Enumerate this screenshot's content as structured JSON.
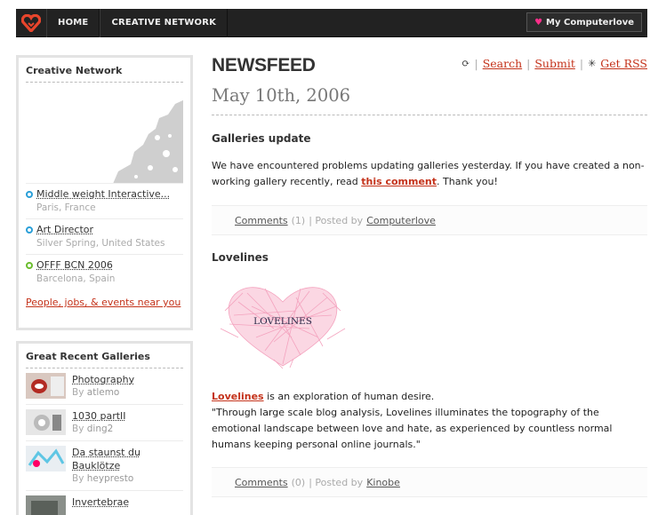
{
  "nav": {
    "home": "HOME",
    "creative_network": "CREATIVE NETWORK",
    "my_computerlove": "My Computerlove"
  },
  "sidebar": {
    "network": {
      "title": "Creative Network",
      "items": [
        {
          "title": "Middle weight Interactive...",
          "location": "Paris, France",
          "status": "blue"
        },
        {
          "title": "Art Director",
          "location": "Silver Spring, United States",
          "status": "blue"
        },
        {
          "title": "OFFF BCN 2006",
          "location": "Barcelona, Spain",
          "status": "green"
        }
      ],
      "near_link": "People, jobs, & events near you"
    },
    "galleries": {
      "title": "Great Recent Galleries",
      "by_label": "By",
      "items": [
        {
          "title": "Photography",
          "author": "atlemo"
        },
        {
          "title": "1030 partII",
          "author": "ding2"
        },
        {
          "title_line1": "Da staunst du",
          "title_line2": "Bauklötze",
          "author": "heypresto"
        },
        {
          "title": "Invertebrae"
        }
      ]
    }
  },
  "main": {
    "heading": "NEWSFEED",
    "links": {
      "search": "Search",
      "submit": "Submit",
      "rss": "Get RSS"
    },
    "date": "May 10th, 2006",
    "posts": [
      {
        "title": "Galleries update",
        "body_before": "We have encountered problems updating galleries yesterday. If you have created a non-working gallery recently, read ",
        "body_link": "this comment",
        "body_after": ". Thank you!",
        "comments_label": "Comments",
        "comments_count": "(1)",
        "posted_by_label": "| Posted by",
        "author": "Computerlove"
      },
      {
        "title": "Lovelines",
        "image_text": "LOVELINES",
        "link": "Lovelines",
        "body_line1": " is an exploration of human desire.",
        "quote": "\"Through large scale blog analysis, Lovelines illuminates the topography of the emotional landscape between love and hate, as experienced by countless normal humans keeping personal online journals.\"",
        "comments_label": "Comments",
        "comments_count": "(0)",
        "posted_by_label": "| Posted by",
        "author": "Kinobe"
      }
    ]
  },
  "colors": {
    "accent": "#c4321a",
    "pink": "#ff2e8a",
    "nav_bg": "#222222"
  }
}
